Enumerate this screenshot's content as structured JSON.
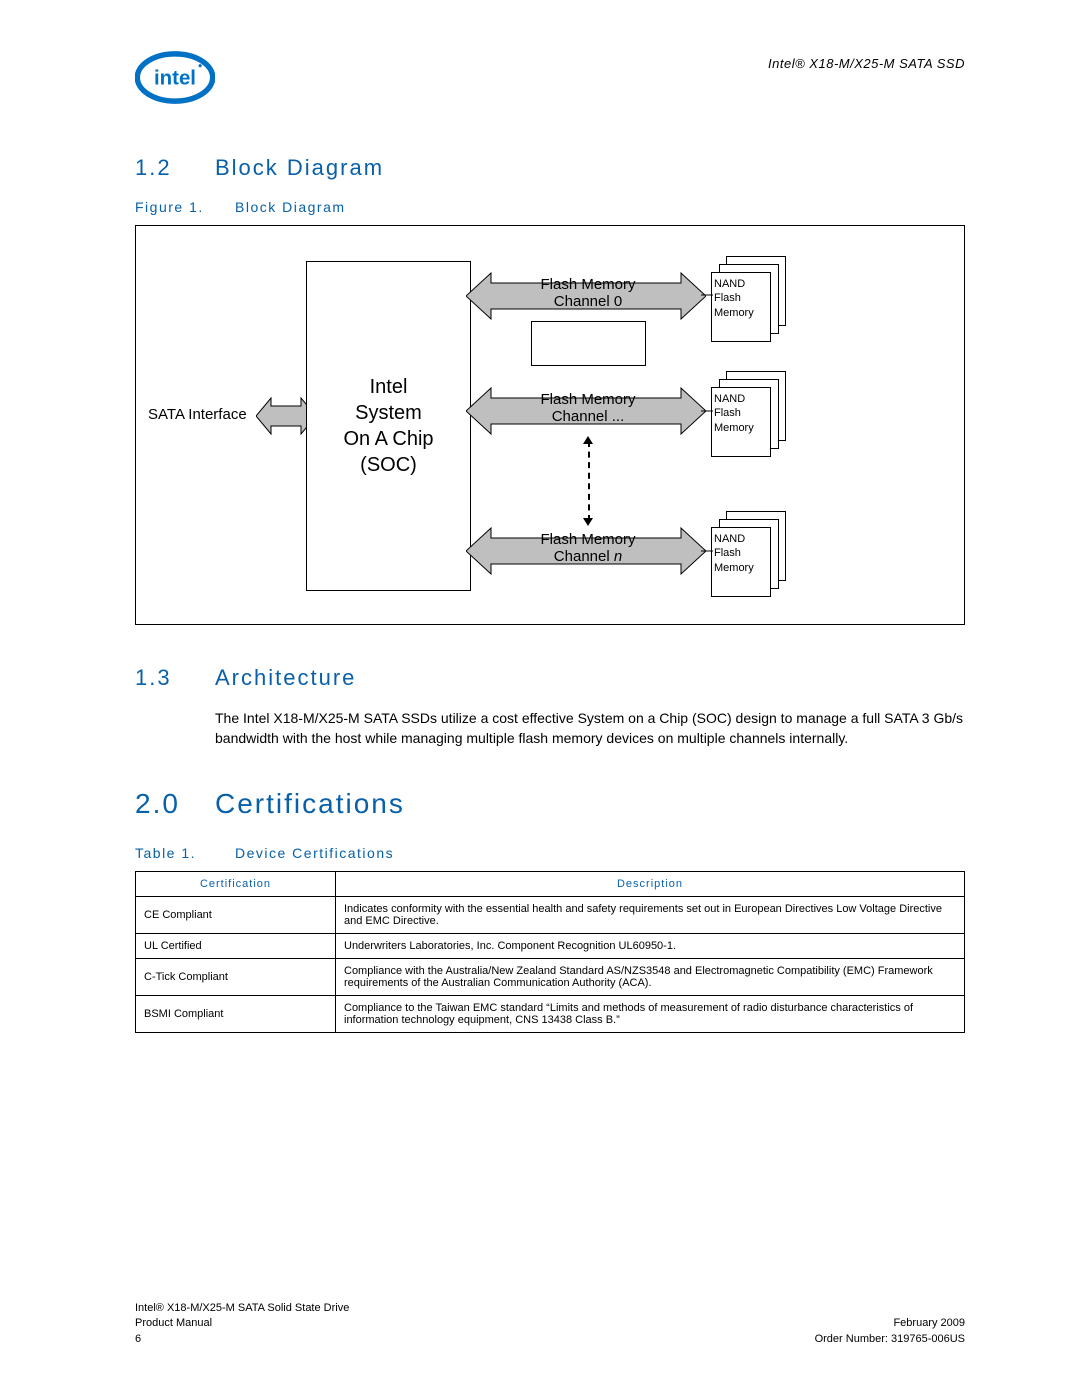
{
  "header": {
    "product": "Intel® X18-M/X25-M SATA SSD"
  },
  "section12": {
    "num": "1.2",
    "title": "Block Diagram"
  },
  "figure1": {
    "label": "Figure 1.",
    "title": "Block Diagram"
  },
  "diagram": {
    "sata": "SATA Interface",
    "soc_l1": "Intel",
    "soc_l2": "System",
    "soc_l3": "On A Chip",
    "soc_l4": "(SOC)",
    "fm0_l1": "Flash Memory",
    "fm0_l2": "Channel 0",
    "fm1_l1": "Flash Memory",
    "fm1_l2": "Channel ...",
    "fmn_l1": "Flash Memory",
    "fmn_l2_a": "Channel ",
    "fmn_l2_b": "n",
    "nand_l1": "NAND",
    "nand_l2": "Flash",
    "nand_l3": "Memory"
  },
  "section13": {
    "num": "1.3",
    "title": "Architecture"
  },
  "arch_text": "The Intel X18-M/X25-M SATA SSDs utilize a cost effective System on a Chip (SOC) design to manage a full SATA 3 Gb/s bandwidth with the host while managing multiple flash memory devices on multiple channels internally.",
  "section20": {
    "num": "2.0",
    "title": "Certifications"
  },
  "table1": {
    "label": "Table 1.",
    "title": "Device Certifications"
  },
  "cert_headers": {
    "c1": "Certification",
    "c2": "Description"
  },
  "cert_rows": [
    {
      "cert": "CE Compliant",
      "desc": "Indicates conformity with the essential health and safety requirements set out in European Directives Low Voltage Directive and EMC Directive."
    },
    {
      "cert": "UL Certified",
      "desc": "Underwriters Laboratories, Inc. Component Recognition UL60950-1."
    },
    {
      "cert": "C-Tick Compliant",
      "desc": "Compliance with the Australia/New Zealand Standard AS/NZS3548 and Electromagnetic Compatibility (EMC) Framework requirements of the Australian Communication Authority (ACA)."
    },
    {
      "cert": "BSMI Compliant",
      "desc": "Compliance to the Taiwan EMC standard “Limits and methods of measurement of radio disturbance characteristics of information technology equipment, CNS 13438 Class B.”"
    }
  ],
  "footer": {
    "left_l1": "Intel® X18-M/X25-M SATA Solid State Drive",
    "left_l2": "Product Manual",
    "left_l3": "6",
    "right_l1": "February 2009",
    "right_l2": "Order Number: 319765-006US"
  }
}
